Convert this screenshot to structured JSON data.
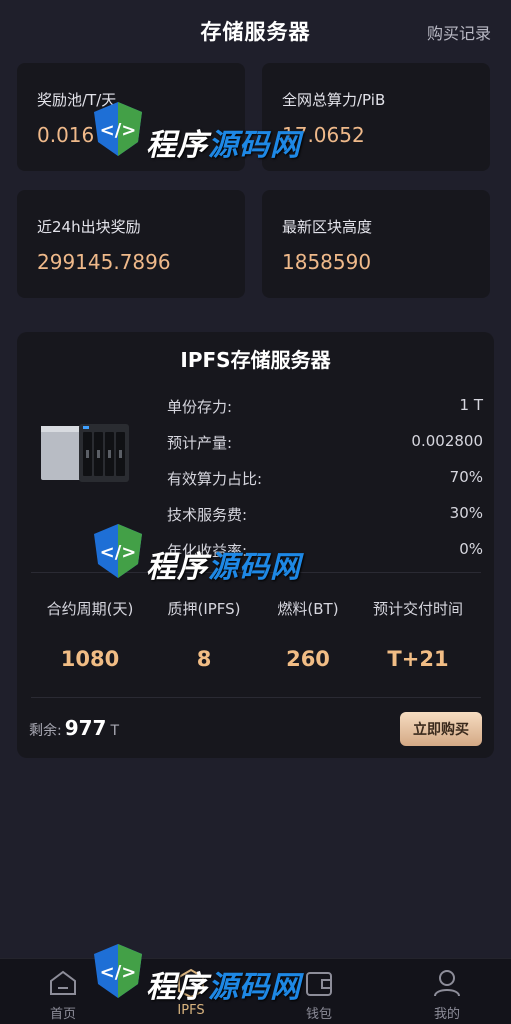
{
  "header": {
    "title": "存储服务器",
    "records_link": "购买记录"
  },
  "stats": [
    {
      "label": "奖励池/T/天",
      "value": "0.016"
    },
    {
      "label": "全网总算力/PiB",
      "value": "17.0652"
    },
    {
      "label": "近24h出块奖励",
      "value": "299145.7896"
    },
    {
      "label": "最新区块高度",
      "value": "1858590"
    }
  ],
  "product": {
    "title": "IPFS存储服务器",
    "specs": [
      {
        "key": "单份存力:",
        "value": "1 T"
      },
      {
        "key": "预计产量:",
        "value": "0.002800"
      },
      {
        "key": "有效算力占比:",
        "value": "70%"
      },
      {
        "key": "技术服务费:",
        "value": "30%"
      },
      {
        "key": "年化收益率:",
        "value": "0%"
      }
    ],
    "metrics": [
      {
        "label": "合约周期(天)",
        "value": "1080"
      },
      {
        "label": "质押(IPFS)",
        "value": "8"
      },
      {
        "label": "燃料(BT)",
        "value": "260"
      },
      {
        "label": "预计交付时间",
        "value": "T+21"
      }
    ],
    "remain_label": "剩余:",
    "remain_value": "977",
    "remain_unit": "T",
    "buy_button": "立即购买"
  },
  "watermark": {
    "text_white": "程序",
    "text_blue": "源码网"
  },
  "nav": [
    {
      "label": "首页",
      "icon": "home-icon",
      "active": false
    },
    {
      "label": "IPFS",
      "icon": "ipfs-icon",
      "active": true
    },
    {
      "label": "钱包",
      "icon": "wallet-icon",
      "active": false
    },
    {
      "label": "我的",
      "icon": "user-icon",
      "active": false
    }
  ],
  "colors": {
    "background": "#1f1f2b",
    "card": "#17171d",
    "accent": "#efb98a",
    "button": "#e6c4a4"
  }
}
